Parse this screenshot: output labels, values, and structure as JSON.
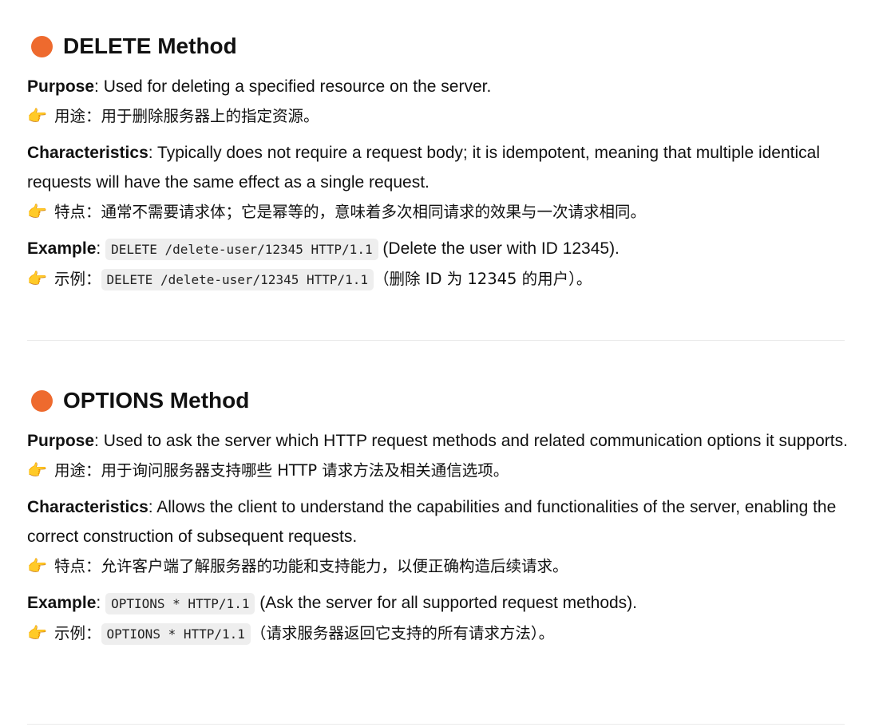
{
  "pointer_icon": "backhand-index-pointing-right-icon",
  "accent_color": "#ee6a2e",
  "delete": {
    "title": "DELETE Method",
    "purpose_label": "Purpose",
    "purpose_text": ": Used for deleting a specified resource on the server.",
    "purpose_zh": "用途：用于删除服务器上的指定资源。",
    "characteristics_label": "Characteristics",
    "characteristics_text": ": Typically does not require a request body; it is idempotent, meaning that multiple identical requests will have the same effect as a single request.",
    "characteristics_zh": "特点：通常不需要请求体；它是幂等的，意味着多次相同请求的效果与一次请求相同。",
    "example_label": "Example",
    "example_colon": ": ",
    "example_code": "DELETE /delete-user/12345 HTTP/1.1",
    "example_note": " (Delete the user with ID 12345).",
    "example_zh_prefix": "示例：",
    "example_zh_code": "DELETE /delete-user/12345 HTTP/1.1",
    "example_zh_note": "（删除 ID 为 12345 的用户）。"
  },
  "options": {
    "title": "OPTIONS Method",
    "purpose_label": "Purpose",
    "purpose_text": ": Used to ask the server which HTTP request methods and related communication options it supports.",
    "purpose_zh": "用途：用于询问服务器支持哪些 HTTP 请求方法及相关通信选项。",
    "characteristics_label": "Characteristics",
    "characteristics_text": ": Allows the client to understand the capabilities and functionalities of the server, enabling the correct construction of subsequent requests.",
    "characteristics_zh": "特点：允许客户端了解服务器的功能和支持能力，以便正确构造后续请求。",
    "example_label": "Example",
    "example_colon": ": ",
    "example_code": "OPTIONS * HTTP/1.1",
    "example_note": " (Ask the server for all supported request methods).",
    "example_zh_prefix": "示例：",
    "example_zh_code": "OPTIONS * HTTP/1.1",
    "example_zh_note": "（请求服务器返回它支持的所有请求方法）。"
  }
}
